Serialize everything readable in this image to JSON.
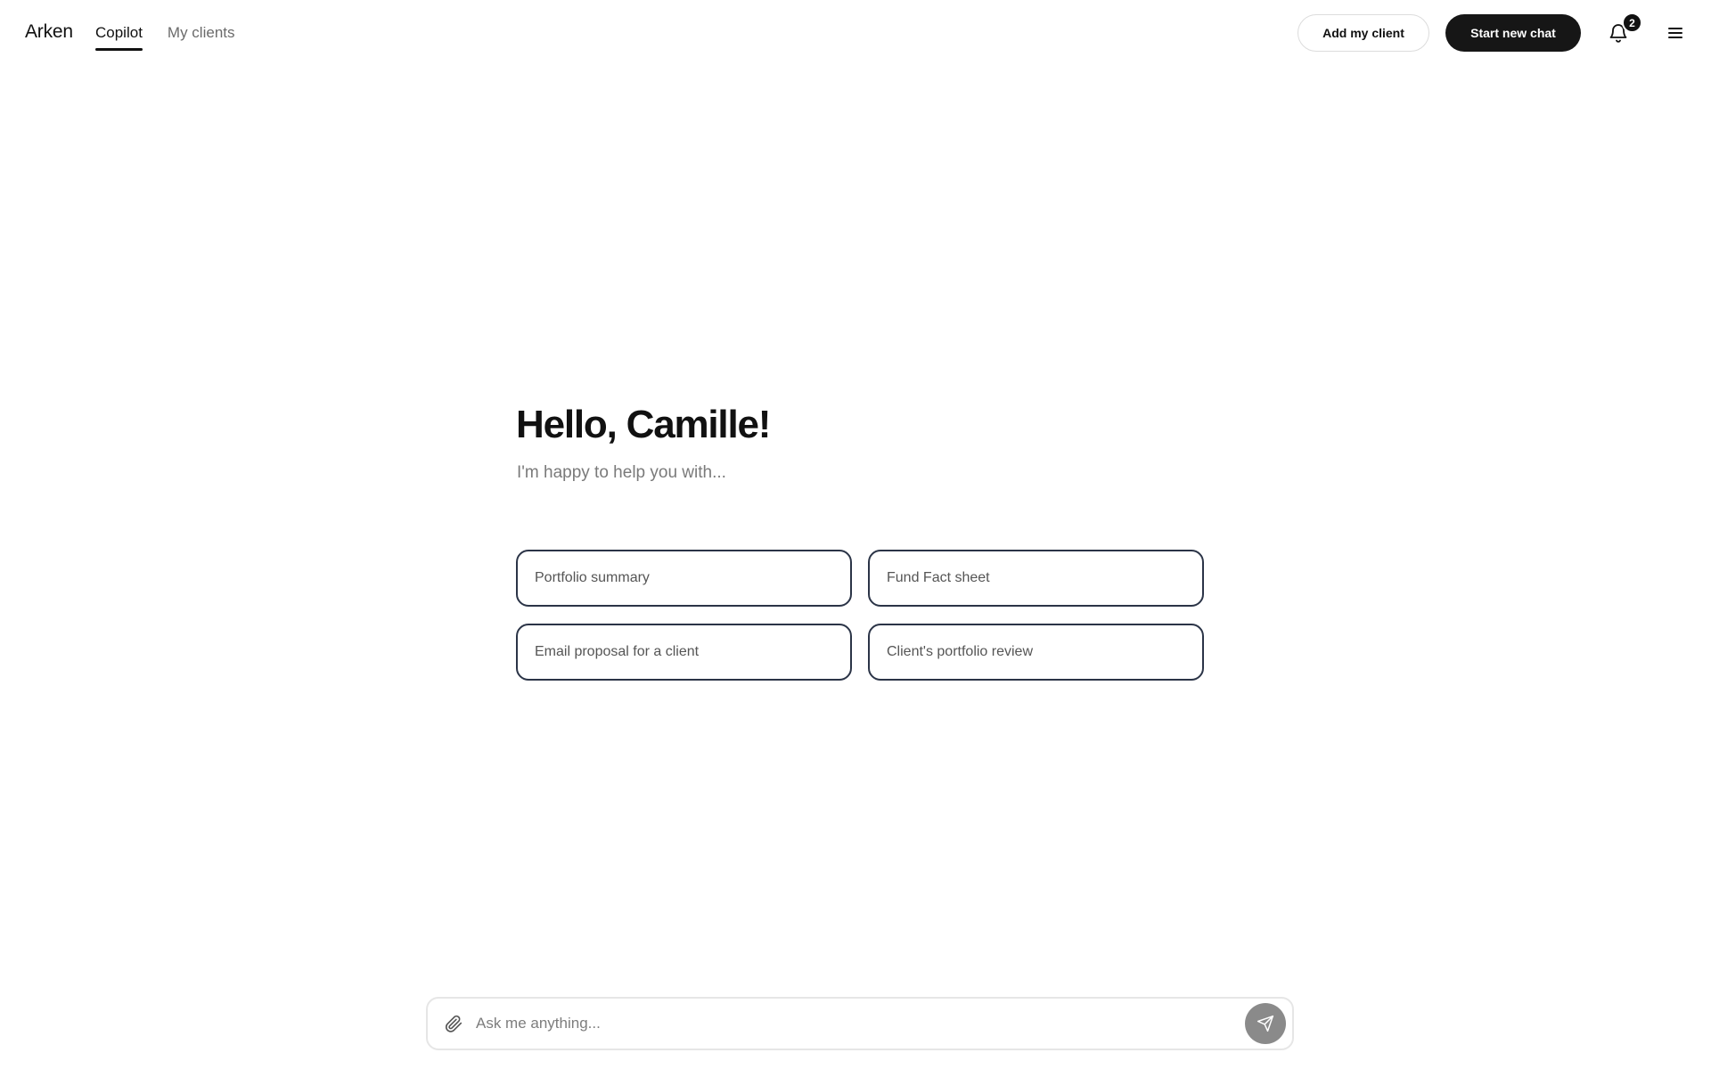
{
  "header": {
    "brand": "Arken",
    "tabs": [
      {
        "label": "Copilot",
        "active": true
      },
      {
        "label": "My clients",
        "active": false
      }
    ],
    "add_client_label": "Add my client",
    "new_chat_label": "Start new chat",
    "notification_count": "2",
    "icons": {
      "notifications": "bell-icon",
      "menu": "hamburger-menu-icon"
    }
  },
  "main": {
    "greeting": "Hello, Camille!",
    "subtitle": "I'm happy to help you with...",
    "suggestions": [
      {
        "label": "Portfolio summary"
      },
      {
        "label": "Fund Fact sheet"
      },
      {
        "label": "Email proposal for a client"
      },
      {
        "label": "Client's portfolio review"
      }
    ]
  },
  "chat": {
    "placeholder": "Ask me anything...",
    "value": "",
    "icons": {
      "attach": "paperclip-icon",
      "send": "send-icon"
    }
  },
  "colors": {
    "primary_button": "#161616",
    "card_border": "#2b3447",
    "send_button": "#8a8a8a"
  }
}
